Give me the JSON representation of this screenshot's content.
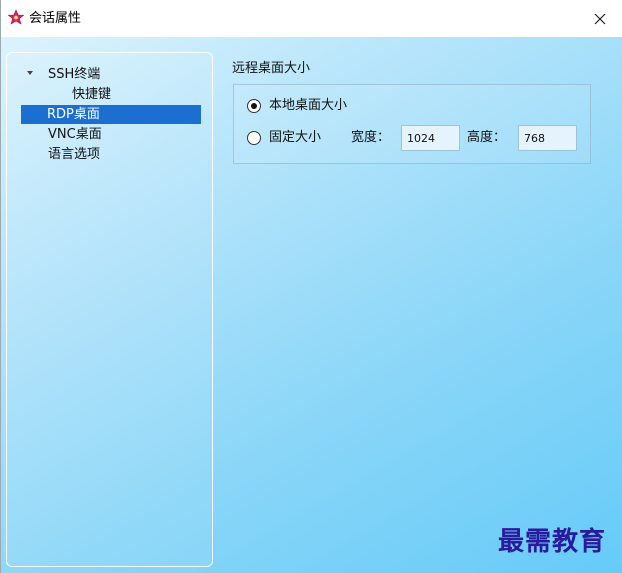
{
  "window": {
    "title": "会话属性",
    "close_glyph": "✕"
  },
  "tree": {
    "items": [
      {
        "label": "SSH终端",
        "expanded": true
      },
      {
        "label": "快捷键"
      },
      {
        "label": "RDP桌面",
        "selected": true
      },
      {
        "label": "VNC桌面"
      },
      {
        "label": "语言选项"
      }
    ]
  },
  "rdp": {
    "section_title": "远程桌面大小",
    "option_local": "本地桌面大小",
    "option_fixed": "固定大小",
    "selected_option": "本地桌面大小",
    "width_label": "宽度：",
    "width_value": "1024",
    "height_label": "高度：",
    "height_value": "768"
  },
  "watermark": "最需教育",
  "colors": {
    "selection": "#1a6fd0",
    "app_icon": "#d6246e",
    "watermark": "#2a1aa0"
  },
  "icons": {
    "app": "app-flower-icon",
    "close": "close-icon",
    "expand": "triangle-down-icon"
  }
}
